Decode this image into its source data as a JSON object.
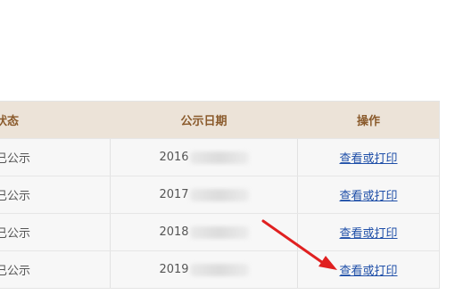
{
  "table": {
    "headers": {
      "status": "状态",
      "date": "公示日期",
      "action": "操作"
    },
    "rows": [
      {
        "status": "已公示",
        "date_prefix": "2016",
        "action": "查看或打印"
      },
      {
        "status": "已公示",
        "date_prefix": "2017",
        "action": "查看或打印"
      },
      {
        "status": "已公示",
        "date_prefix": "2018",
        "action": "查看或打印"
      },
      {
        "status": "已公示",
        "date_prefix": "2019",
        "action": "查看或打印"
      }
    ]
  },
  "colors": {
    "header_bg": "#ece3d8",
    "header_text": "#8a5a2b",
    "link": "#1f4fa8",
    "arrow": "#e02020"
  },
  "annotation": {
    "icon": "arrow-icon"
  }
}
